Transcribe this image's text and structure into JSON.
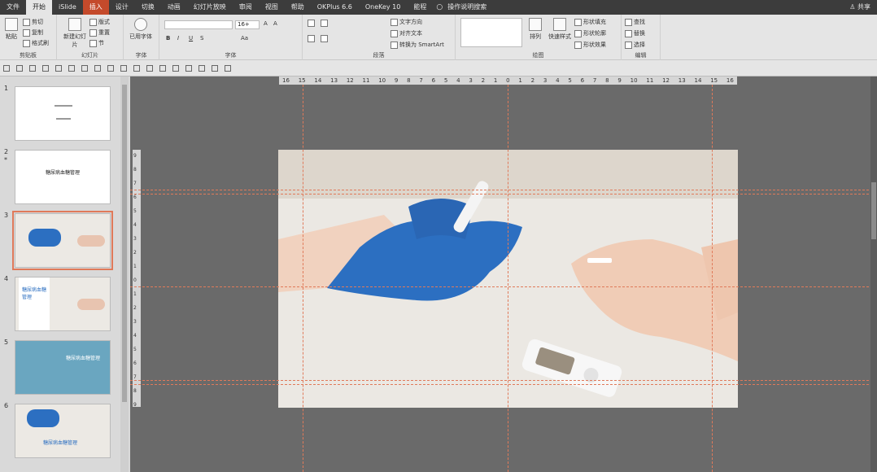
{
  "menu": {
    "tabs": [
      "文件",
      "开始",
      "iSlide",
      "插入",
      "设计",
      "切换",
      "动画",
      "幻灯片放映",
      "审阅",
      "视图",
      "帮助",
      "OKPlus 6.6",
      "OneKey 10",
      "能程"
    ],
    "search_label": "操作说明搜索",
    "share_label": "共享"
  },
  "ribbon": {
    "clipboard": {
      "paste": "粘贴",
      "cut": "剪切",
      "copy": "复制",
      "format_painter": "格式刷",
      "label": "剪贴板"
    },
    "slides": {
      "new_slide": "新建幻灯片",
      "layout": "版式",
      "reset": "重置",
      "section": "节",
      "label": "幻灯片"
    },
    "font_group": {
      "font_used": "已用字体",
      "label": "字体"
    },
    "font": {
      "name_value": "",
      "size_value": "16+",
      "label": "字体"
    },
    "paragraph": {
      "text_direction": "文字方向",
      "align_text": "对齐文本",
      "smartart": "转换为 SmartArt",
      "label": "段落"
    },
    "drawing": {
      "arrange": "排列",
      "quick_styles": "快速样式",
      "shape_fill": "形状填充",
      "shape_outline": "形状轮廓",
      "shape_effects": "形状效果",
      "label": "绘图"
    },
    "editing": {
      "find": "查找",
      "replace": "替换",
      "select": "选择",
      "label": "编辑"
    }
  },
  "ruler": {
    "h_ticks": [
      "16",
      "15",
      "14",
      "13",
      "12",
      "11",
      "10",
      "9",
      "8",
      "7",
      "6",
      "5",
      "4",
      "3",
      "2",
      "1",
      "0",
      "1",
      "2",
      "3",
      "4",
      "5",
      "6",
      "7",
      "8",
      "9",
      "10",
      "11",
      "12",
      "13",
      "14",
      "15",
      "16"
    ],
    "v_ticks": [
      "9",
      "8",
      "7",
      "6",
      "5",
      "4",
      "3",
      "2",
      "1",
      "0",
      "1",
      "2",
      "3",
      "4",
      "5",
      "6",
      "7",
      "8",
      "9"
    ]
  },
  "thumbnails": [
    {
      "num": "1",
      "title": "",
      "subtitle": ""
    },
    {
      "num": "2",
      "title": "糖尿病血糖管理",
      "subtitle": "",
      "starred": "*"
    },
    {
      "num": "3",
      "title": ""
    },
    {
      "num": "4",
      "title": "糖尿病血糖管理"
    },
    {
      "num": "5",
      "title": "糖尿病血糖管理"
    },
    {
      "num": "6",
      "title": "糖尿病血糖管理"
    }
  ],
  "colors": {
    "accent": "#c44a2b",
    "guide": "#e07a5a",
    "glove": "#2c6fc1"
  }
}
